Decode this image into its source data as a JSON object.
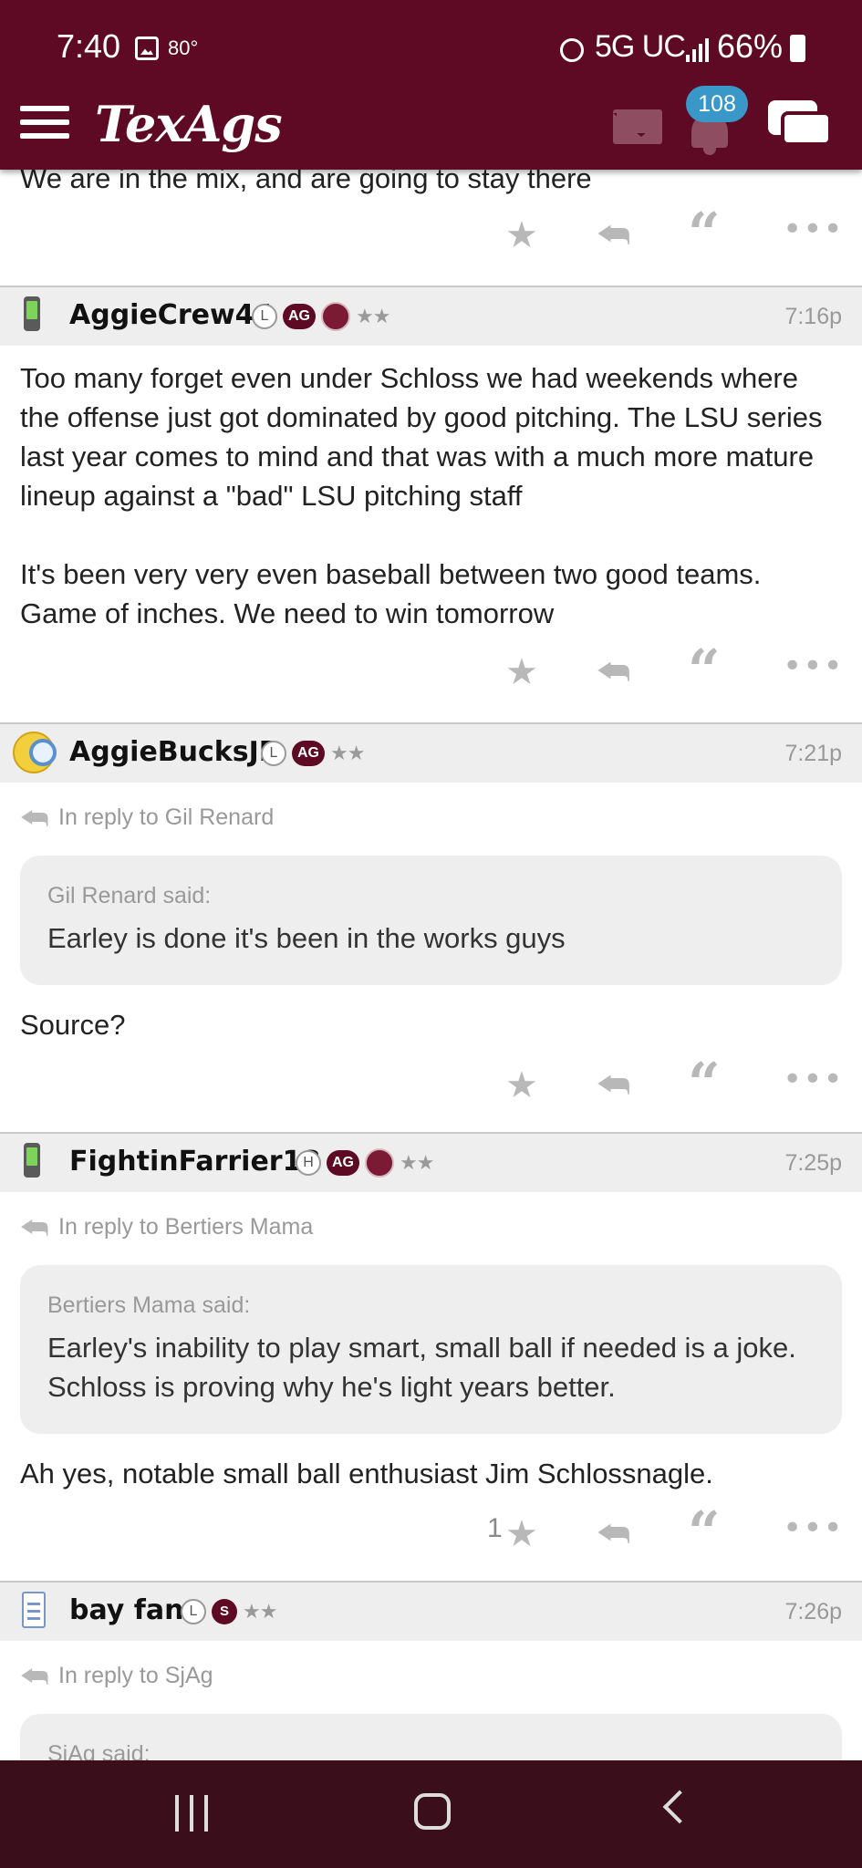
{
  "status_bar": {
    "time": "7:40",
    "temperature": "80°",
    "network": "5G UC",
    "battery": "66%"
  },
  "nav": {
    "logo": "TexAgs",
    "notification_count": "108",
    "icons": [
      "menu-icon",
      "mail-icon",
      "bell-icon",
      "chat-icon"
    ]
  },
  "colors": {
    "brand_maroon": "#5e0a25",
    "badge_blue": "#3a98c9",
    "header_gray": "#eeeeee",
    "action_gray": "#b8b8b8"
  },
  "partial_post": {
    "text": "We are in the mix, and are going to stay there"
  },
  "posts": [
    {
      "username": "AggieCrew44",
      "badges": [
        "L",
        "AG"
      ],
      "time": "7:16p",
      "body": [
        "Too many forget even under Schloss we had weekends where the offense just got dominated by good pitching. The LSU series last year comes to mind and that was with a much more mature lineup against a \"bad\" LSU pitching staff",
        "It's been very very even baseball between two good teams. Game of inches. We need to win tomorrow"
      ]
    },
    {
      "username": "AggieBucksJB",
      "badges": [
        "L",
        "AG"
      ],
      "time": "7:21p",
      "reply_to": "In reply to Gil Renard",
      "quote_author": "Gil Renard said:",
      "quote_text": "Earley is done it's been in the works guys",
      "body": "Source?"
    },
    {
      "username": "FightinFarrier18",
      "badges": [
        "H",
        "AG"
      ],
      "time": "7:25p",
      "reply_to": "In reply to Bertiers Mama",
      "quote_author": "Bertiers Mama said:",
      "quote_text": "Earley's inability to play smart, small ball if needed is a joke. Schloss is proving why he's light years better.",
      "body": "Ah yes, notable small ball enthusiast Jim Schlossnagle.",
      "star_count": "1"
    },
    {
      "username": "bay fan",
      "badges": [
        "L",
        "S"
      ],
      "time": "7:26p",
      "reply_to": "In reply to SjAg",
      "quote_author": "SjAg said:"
    }
  ]
}
